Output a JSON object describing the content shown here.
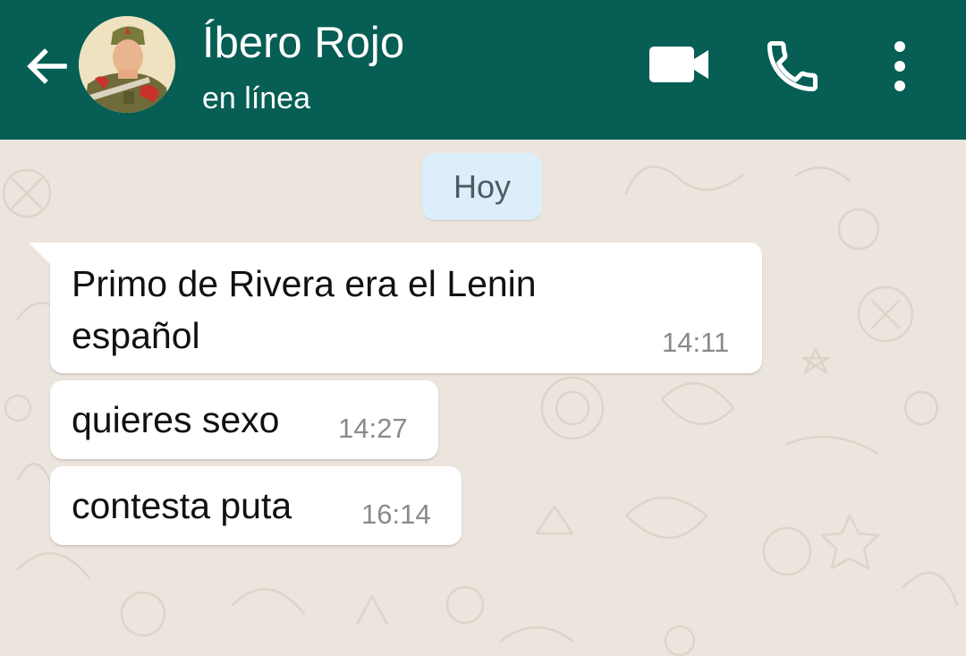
{
  "header": {
    "contact_name": "Íbero Rojo",
    "status": "en línea",
    "background_color": "#075e54",
    "icons": [
      "back-arrow-icon",
      "video-call-icon",
      "phone-icon",
      "more-vertical-icon"
    ]
  },
  "chat": {
    "date_label": "Hoy",
    "messages": [
      {
        "lines": [
          "Primo de Rivera era el Lenin",
          "español"
        ],
        "time": "14:11",
        "direction": "incoming"
      },
      {
        "lines": [
          "quieres sexo"
        ],
        "time": "14:27",
        "direction": "incoming"
      },
      {
        "lines": [
          "contesta puta"
        ],
        "time": "16:14",
        "direction": "incoming"
      }
    ]
  }
}
